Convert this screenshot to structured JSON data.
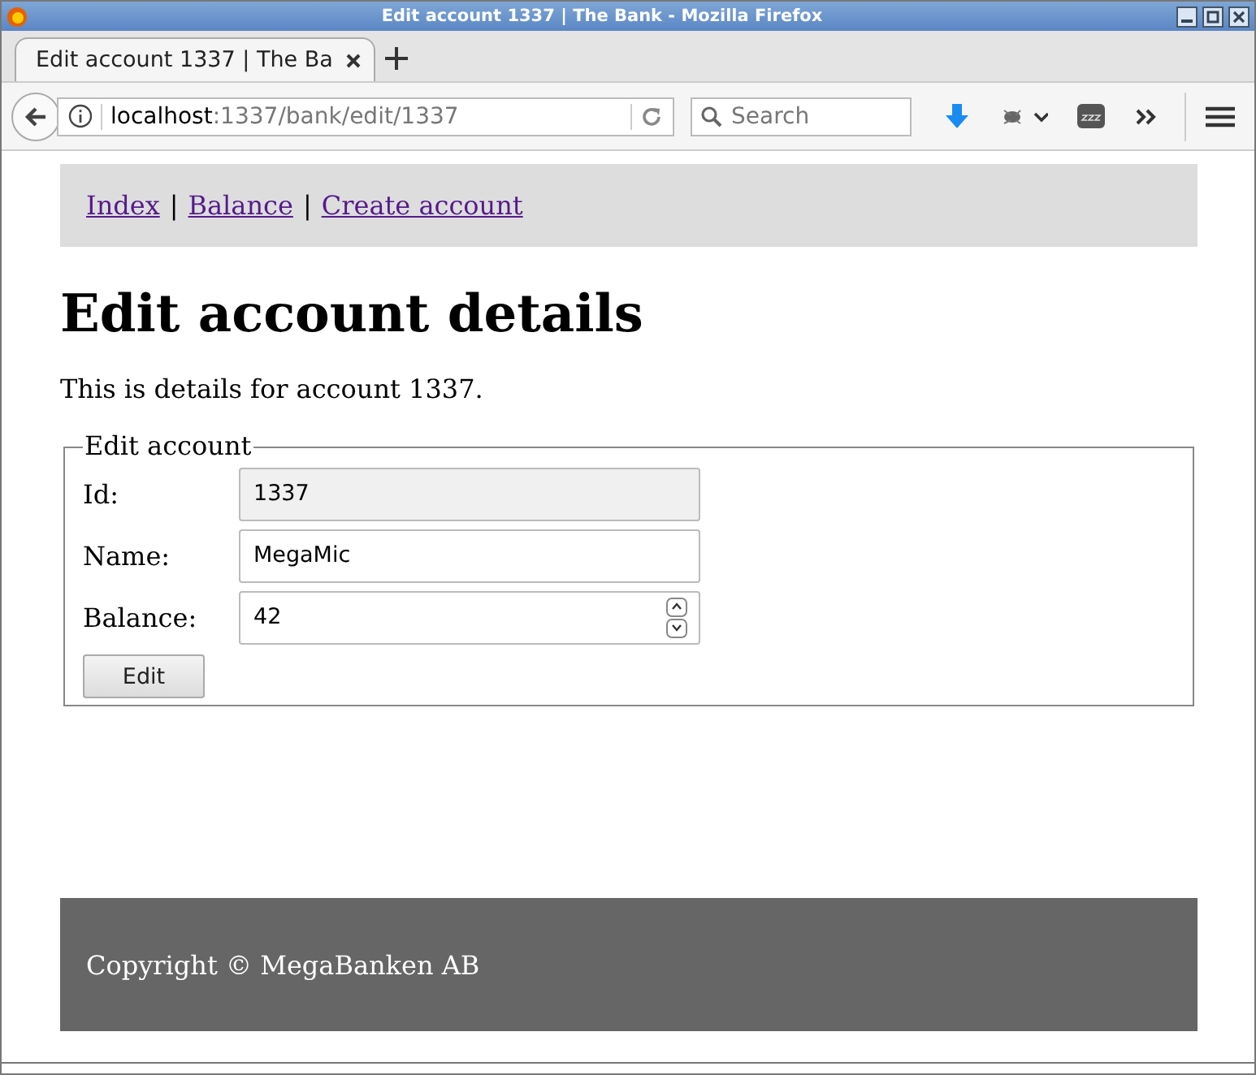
{
  "window": {
    "title": "Edit account 1337 | The Bank - Mozilla Firefox"
  },
  "tabs": [
    {
      "label": "Edit account 1337 | The Ba",
      "selected": true
    }
  ],
  "toolbar": {
    "url_host": "localhost",
    "url_path": ":1337/bank/edit/1337",
    "search": {
      "placeholder": "Search"
    }
  },
  "nav": [
    {
      "kind": "link",
      "text": "Index"
    },
    {
      "kind": "separator",
      "text": "|"
    },
    {
      "kind": "link",
      "text": "Balance"
    },
    {
      "kind": "separator",
      "text": "|"
    },
    {
      "kind": "link",
      "text": "Create account"
    }
  ],
  "heading": "Edit account details",
  "intro": "This is details for account 1337.",
  "form": {
    "legend": "Edit account",
    "fields": [
      {
        "label": "Id:",
        "value": "1337",
        "kind": "text",
        "disabled": true
      },
      {
        "label": "Name:",
        "value": "MegaMic",
        "kind": "text",
        "disabled": false
      },
      {
        "label": "Balance:",
        "value": "42",
        "kind": "number",
        "disabled": false
      }
    ],
    "submit": "Edit"
  },
  "footer": "Copyright © MegaBanken AB"
}
